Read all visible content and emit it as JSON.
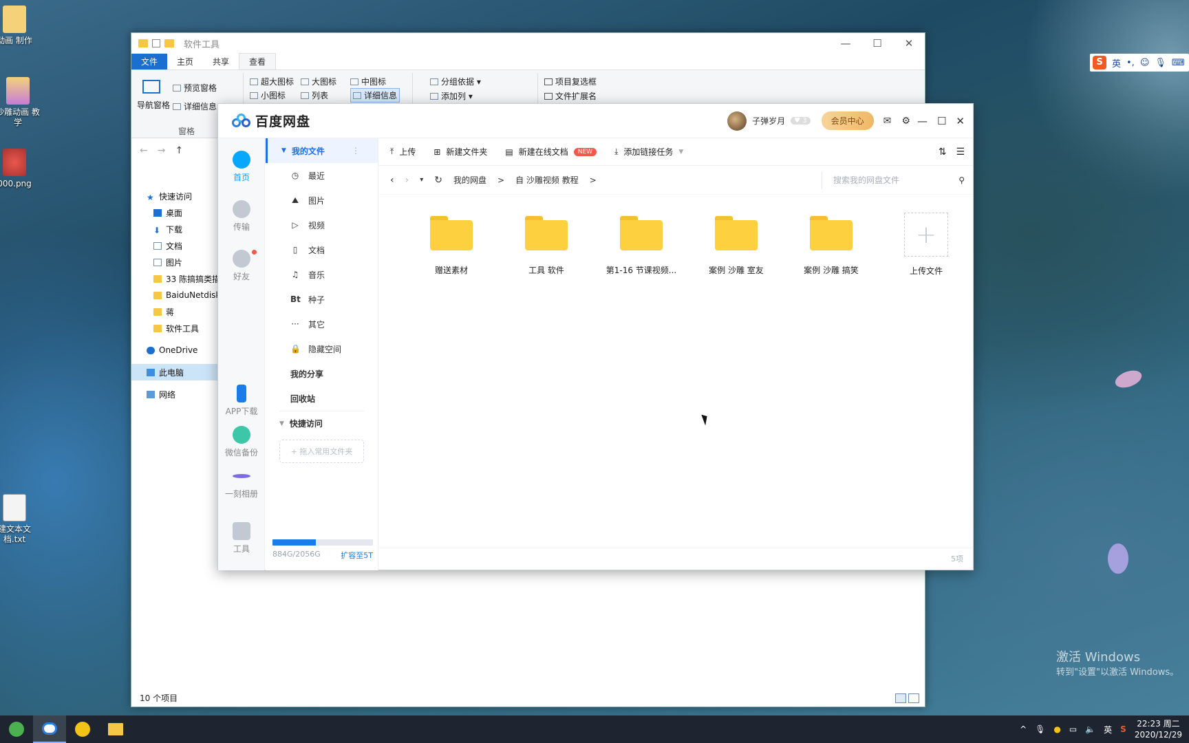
{
  "desktop": {
    "icons": [
      {
        "label": "动画 制作"
      },
      {
        "label": "沙雕动画 教学"
      },
      {
        "label": "000.png"
      },
      {
        "label": "建文本文 档.txt"
      }
    ],
    "activation": {
      "line1": "激活 Windows",
      "line2": "转到\"设置\"以激活 Windows。"
    }
  },
  "ime": {
    "lang": "英",
    "punct": "•,"
  },
  "explorer": {
    "title": "软件工具",
    "tabs": [
      "文件",
      "主页",
      "共享",
      "查看"
    ],
    "ribbon": {
      "nav_pane": "导航窗格",
      "preview_pane": "预览窗格",
      "details_pane": "详细信息",
      "group_label": "窗格",
      "xl_icons": "超大图标",
      "large_icons": "大图标",
      "medium_icons": "中图标",
      "small_icons": "小图标",
      "list": "列表",
      "details": "详细信息",
      "group_by": "分组依据",
      "add_column": "添加列",
      "item_checkbox": "项目复选框",
      "file_ext": "文件扩展名"
    },
    "nav": {
      "quick_access": "快速访问",
      "items": [
        "桌面",
        "下载",
        "文档",
        "图片",
        "33 陈搞搞类描",
        "BaiduNetdisk",
        "蒋",
        "软件工具"
      ],
      "onedrive": "OneDrive",
      "this_pc": "此电脑",
      "network": "网络"
    },
    "status": "10 个项目"
  },
  "baidu": {
    "app_name": "百度网盘",
    "user": {
      "name": "子弹岁月",
      "level": "3",
      "vip_button": "会员中心"
    },
    "left_nav": [
      {
        "label": "首页"
      },
      {
        "label": "传输"
      },
      {
        "label": "好友"
      },
      {
        "label": "APP下载"
      },
      {
        "label": "微信备份"
      },
      {
        "label": "一刻相册"
      },
      {
        "label": "工具"
      }
    ],
    "side": {
      "my_files": "我的文件",
      "items": [
        {
          "icon": "◷",
          "label": "最近"
        },
        {
          "icon": "⛰",
          "label": "图片"
        },
        {
          "icon": "▷",
          "label": "视频"
        },
        {
          "icon": "▯",
          "label": "文档"
        },
        {
          "icon": "♫",
          "label": "音乐"
        },
        {
          "icon": "Bt",
          "label": "种子"
        },
        {
          "icon": "···",
          "label": "其它"
        },
        {
          "icon": "🔒",
          "label": "隐藏空间"
        }
      ],
      "my_share": "我的分享",
      "recycle": "回收站",
      "quick": "快捷访问",
      "drop_hint": "+ 拖入常用文件夹",
      "quota_used": "884G/2056G",
      "quota_fraction": 0.43,
      "expand": "扩容至5T"
    },
    "toolbar": {
      "upload": "上传",
      "new_folder": "新建文件夹",
      "new_doc": "新建在线文档",
      "new_badge": "NEW",
      "add_link": "添加链接任务"
    },
    "breadcrumb": {
      "root": "我的网盘",
      "sep": ">",
      "current": "自 沙雕视频 教程",
      "sep2": ">"
    },
    "search_placeholder": "搜索我的网盘文件",
    "files": [
      {
        "name": "赠送素材"
      },
      {
        "name": "工具 软件"
      },
      {
        "name": "第1-16 节课视频..."
      },
      {
        "name": "案例 沙雕 室友"
      },
      {
        "name": "案例 沙雕 搞笑"
      }
    ],
    "upload_tile": "上传文件",
    "count": "5项"
  },
  "taskbar": {
    "lang": "英",
    "time": "22:23 周二",
    "date": "2020/12/29"
  }
}
